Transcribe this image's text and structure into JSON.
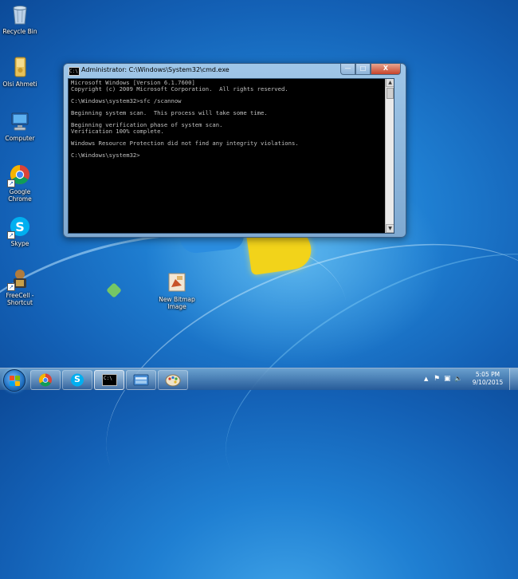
{
  "desktop": {
    "icons": [
      {
        "label": "Recycle Bin"
      },
      {
        "label": "Olsi Ahmeti"
      },
      {
        "label": "Computer"
      },
      {
        "label": "Google Chrome"
      },
      {
        "label": "Skype"
      },
      {
        "label": "FreeCell - Shortcut"
      },
      {
        "label": "New Bitmap Image"
      }
    ]
  },
  "window": {
    "title": "Administrator: C:\\Windows\\System32\\cmd.exe",
    "icon_text": "C:\\",
    "buttons": {
      "minimize": "—",
      "maximize": "□",
      "close": "X"
    },
    "console_text": "Microsoft Windows [Version 6.1.7600]\nCopyright (c) 2009 Microsoft Corporation.  All rights reserved.\n\nC:\\Windows\\system32>sfc /scannow\n\nBeginning system scan.  This process will take some time.\n\nBeginning verification phase of system scan.\nVerification 100% complete.\n\nWindows Resource Protection did not find any integrity violations.\n\nC:\\Windows\\system32>"
  },
  "taskbar": {
    "items": [
      {
        "name": "chrome"
      },
      {
        "name": "skype",
        "glyph": "S"
      },
      {
        "name": "cmd",
        "glyph": "C:\\"
      },
      {
        "name": "explorer"
      },
      {
        "name": "paint"
      }
    ],
    "tray": {
      "show_hidden": "▲",
      "flag": "⚑",
      "network": "▣",
      "volume": "🔈"
    },
    "clock": {
      "time": "5:05 PM",
      "date": "9/10/2015"
    }
  },
  "colors": {
    "console_bg": "#000000",
    "console_fg": "#c0c0c0",
    "desktop": "#1f7fd2"
  }
}
